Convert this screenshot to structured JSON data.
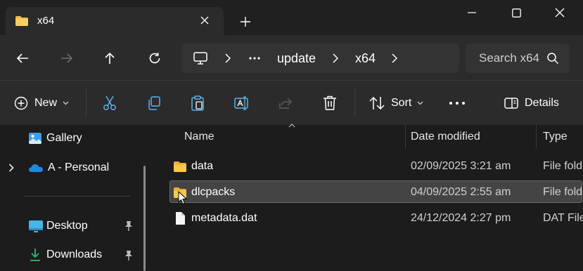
{
  "tab": {
    "title": "x64"
  },
  "nav": {
    "path": [
      "update",
      "x64"
    ]
  },
  "search": {
    "placeholder": "Search x64"
  },
  "toolbar": {
    "new_label": "New",
    "sort_label": "Sort",
    "details_label": "Details"
  },
  "sidebar": {
    "items": [
      {
        "label": "Gallery"
      },
      {
        "label": "A - Personal"
      },
      {
        "label": "Desktop"
      },
      {
        "label": "Downloads"
      }
    ]
  },
  "files": {
    "columns": [
      "Name",
      "Date modified",
      "Type"
    ],
    "rows": [
      {
        "name": "data",
        "date": "02/09/2025 3:21 am",
        "type": "File fold",
        "kind": "folder"
      },
      {
        "name": "dlcpacks",
        "date": "04/09/2025 2:55 am",
        "type": "File fold",
        "kind": "folder",
        "selected": true
      },
      {
        "name": "metadata.dat",
        "date": "24/12/2024 2:27 pm",
        "type": "DAT File",
        "kind": "file"
      }
    ]
  },
  "colors": {
    "folder": "#f5c04a",
    "background": "#1c1c1c",
    "bar": "#2b2b2b",
    "selected": "#444444"
  }
}
